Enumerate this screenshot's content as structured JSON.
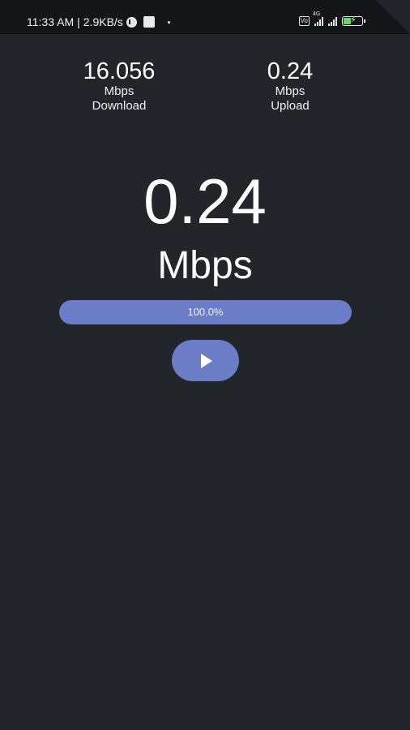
{
  "status_bar": {
    "time": "11:33 AM",
    "separator": "|",
    "net_speed": "2.9KB/s",
    "network_tag": "4G",
    "icons": [
      "vpn-key-icon",
      "app-notification-icon",
      "dot-icon",
      "volte-icon",
      "signal-icon",
      "signal-icon",
      "battery-charging-icon"
    ],
    "battery_color": "#6fd56a"
  },
  "download": {
    "value": "16.056",
    "unit": "Mbps",
    "label": "Download"
  },
  "upload": {
    "value": "0.24",
    "unit": "Mbps",
    "label": "Upload"
  },
  "current": {
    "value": "0.24",
    "unit": "Mbps"
  },
  "progress": {
    "percent": 100.0,
    "text": "100.0%"
  },
  "play_button": {
    "icon": "play-icon"
  },
  "colors": {
    "background": "#22262a",
    "status_bar": "#131518",
    "accent": "#6a7dc6"
  }
}
